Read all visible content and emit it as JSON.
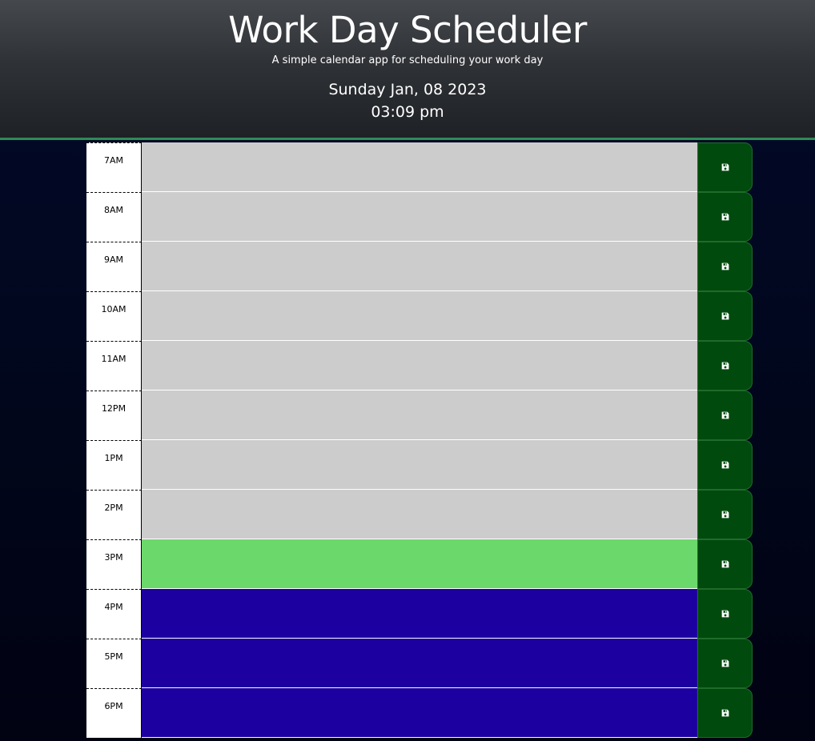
{
  "header": {
    "title": "Work Day Scheduler",
    "subtitle": "A simple calendar app for scheduling your work day",
    "date": "Sunday Jan, 08 2023",
    "time": "03:09 pm"
  },
  "colors": {
    "past": "#cccccc",
    "present": "#6bd86b",
    "future": "#1d00a0",
    "save_button": "#014a0e"
  },
  "save_icon": "floppy-disk-icon",
  "time_blocks": [
    {
      "hour": "7AM",
      "state": "past",
      "text": ""
    },
    {
      "hour": "8AM",
      "state": "past",
      "text": ""
    },
    {
      "hour": "9AM",
      "state": "past",
      "text": ""
    },
    {
      "hour": "10AM",
      "state": "past",
      "text": ""
    },
    {
      "hour": "11AM",
      "state": "past",
      "text": ""
    },
    {
      "hour": "12PM",
      "state": "past",
      "text": ""
    },
    {
      "hour": "1PM",
      "state": "past",
      "text": ""
    },
    {
      "hour": "2PM",
      "state": "past",
      "text": ""
    },
    {
      "hour": "3PM",
      "state": "present",
      "text": ""
    },
    {
      "hour": "4PM",
      "state": "future",
      "text": ""
    },
    {
      "hour": "5PM",
      "state": "future",
      "text": ""
    },
    {
      "hour": "6PM",
      "state": "future",
      "text": ""
    }
  ]
}
